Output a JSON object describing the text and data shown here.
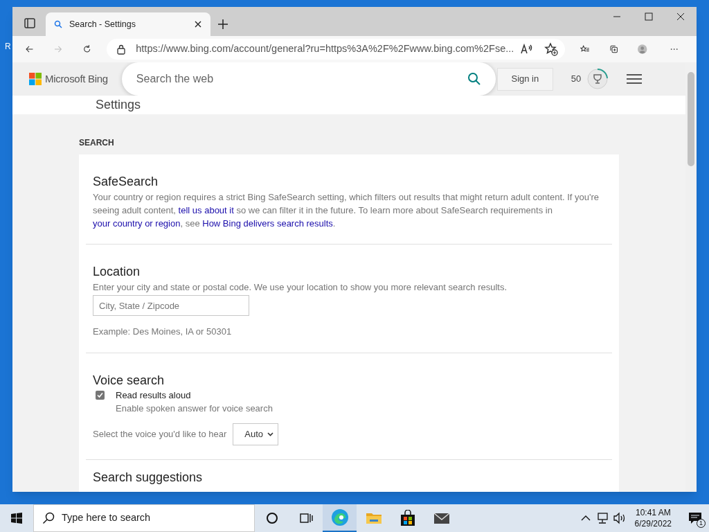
{
  "desktop": {
    "icon_label": "R"
  },
  "browser": {
    "tabs": [
      {
        "title": "Search - Settings",
        "selected": true
      }
    ],
    "address": "https://www.bing.com/account/general?ru=https%3A%2F%2Fwww.bing.com%2Fse..."
  },
  "header": {
    "logo": "Microsoft Bing",
    "search_placeholder": "Search the web",
    "sign_in": "Sign in",
    "points": "50"
  },
  "page_title": "Settings",
  "section_label": "SEARCH",
  "sections": [
    {
      "kind": "text",
      "title": "SafeSearch",
      "paragraph": [
        {
          "kind": "text",
          "text": "Your country or region requires a strict Bing SafeSearch setting, which filters out results that might return adult content. If you're seeing adult content, "
        },
        {
          "kind": "link",
          "text": "tell us about it"
        },
        {
          "kind": "text",
          "text": " so we can filter it in the future. To learn more about SafeSearch requirements in "
        },
        {
          "kind": "link",
          "text": "your country or region"
        },
        {
          "kind": "text",
          "text": ", see "
        },
        {
          "kind": "link",
          "text": "How Bing delivers search results"
        },
        {
          "kind": "text",
          "text": "."
        }
      ]
    },
    {
      "kind": "location",
      "title": "Location",
      "description": "Enter your city and state or postal code. We use your location to show you more relevant search results.",
      "placeholder": "City, State / Zipcode",
      "example": "Example: Des Moines, IA or 50301"
    },
    {
      "kind": "voice",
      "title": "Voice search",
      "checkbox": {
        "label": "Read results aloud",
        "sublabel": "Enable spoken answer for voice search",
        "checked": true
      },
      "select_label": "Select the voice you'd like to hear",
      "select_value": "Auto"
    },
    {
      "kind": "heading",
      "title": "Search suggestions"
    }
  ],
  "taskbar": {
    "search_placeholder": "Type here to search",
    "time": "10:41 AM",
    "date": "6/29/2022",
    "notifications": "1"
  }
}
